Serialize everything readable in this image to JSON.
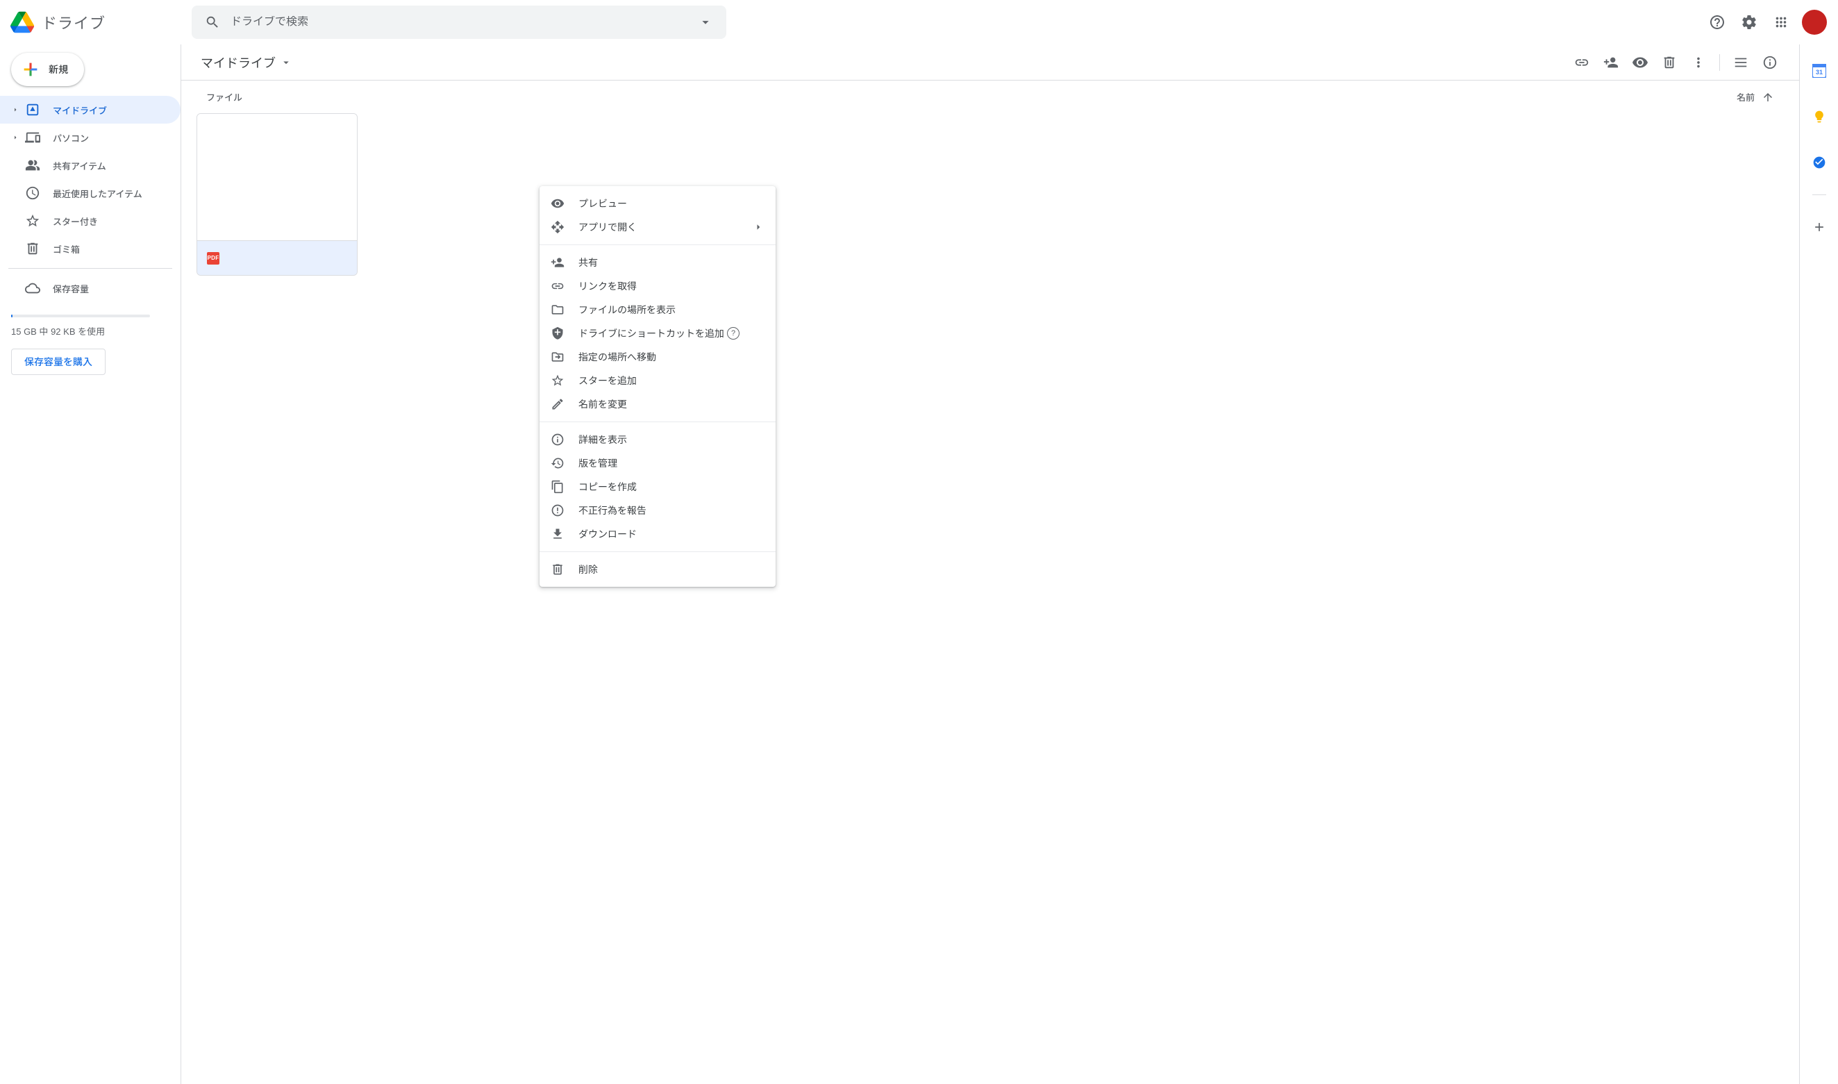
{
  "brand": "ドライブ",
  "search": {
    "placeholder": "ドライブで検索"
  },
  "new_button": "新規",
  "sidebar": {
    "items": [
      {
        "label": "マイドライブ"
      },
      {
        "label": "パソコン"
      },
      {
        "label": "共有アイテム"
      },
      {
        "label": "最近使用したアイテム"
      },
      {
        "label": "スター付き"
      },
      {
        "label": "ゴミ箱"
      }
    ],
    "storage_label": "保存容量",
    "storage_text": "15 GB 中 92 KB を使用",
    "buy_label": "保存容量を購入"
  },
  "main": {
    "breadcrumb": "マイドライブ",
    "section": "ファイル",
    "sort_col": "名前",
    "file": {
      "name": "",
      "badge": "PDF"
    }
  },
  "ctx": {
    "preview": "プレビュー",
    "open_with": "アプリで開く",
    "share": "共有",
    "get_link": "リンクを取得",
    "show_location": "ファイルの場所を表示",
    "add_shortcut": "ドライブにショートカットを追加",
    "move_to": "指定の場所へ移動",
    "add_star": "スターを追加",
    "rename": "名前を変更",
    "details": "詳細を表示",
    "manage_versions": "版を管理",
    "make_copy": "コピーを作成",
    "report": "不正行為を報告",
    "download": "ダウンロード",
    "remove": "削除"
  }
}
